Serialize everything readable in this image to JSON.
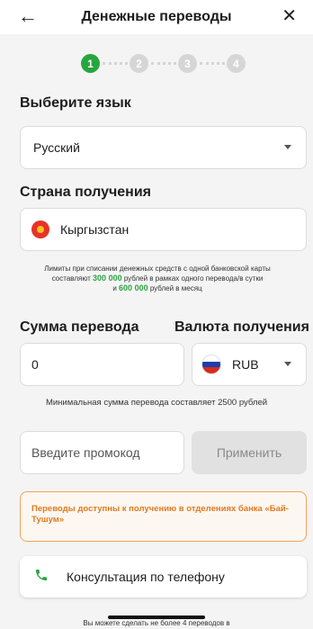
{
  "header": {
    "back_icon": "arrow-left-icon",
    "title": "Денежные переводы",
    "close_icon": "close-icon"
  },
  "steps": [
    {
      "label": "1",
      "state": "active"
    },
    {
      "label": "2",
      "state": "inactive"
    },
    {
      "label": "3",
      "state": "inactive"
    },
    {
      "label": "4",
      "state": "inactive"
    }
  ],
  "language": {
    "title": "Выберите язык",
    "value": "Русский"
  },
  "country": {
    "title": "Страна получения",
    "value": "Кыргызстан",
    "flag_icon": "kyrgyzstan-flag-icon"
  },
  "limits": {
    "line1_pre": "Лимиты при списании денежных средств с одной банковской карты составляют ",
    "amount1": "300 000",
    "line1_post": " рублей в рамках одного перевода/в сутки",
    "line2_pre": "и ",
    "amount2": "600 000",
    "line2_post": " рублей в месяц"
  },
  "amount": {
    "title": "Сумма перевода",
    "value": "0"
  },
  "currency": {
    "title": "Валюта получения",
    "value": "RUB",
    "flag_icon": "russia-flag-icon"
  },
  "min_note": "Минимальная сумма перевода составляет 2500 рублей",
  "promo": {
    "placeholder": "Введите промокод",
    "apply_label": "Применить"
  },
  "notice": "Переводы доступны к получению в отделениях банка «Бай-Тушум»",
  "consult": {
    "icon": "phone-icon",
    "label": "Консультация по телефону"
  },
  "bottom_note": "Вы можете сделать не более 4 переводов в",
  "colors": {
    "accent": "#27a63f",
    "warning": "#e07a1f",
    "background": "#f4f4f4"
  }
}
